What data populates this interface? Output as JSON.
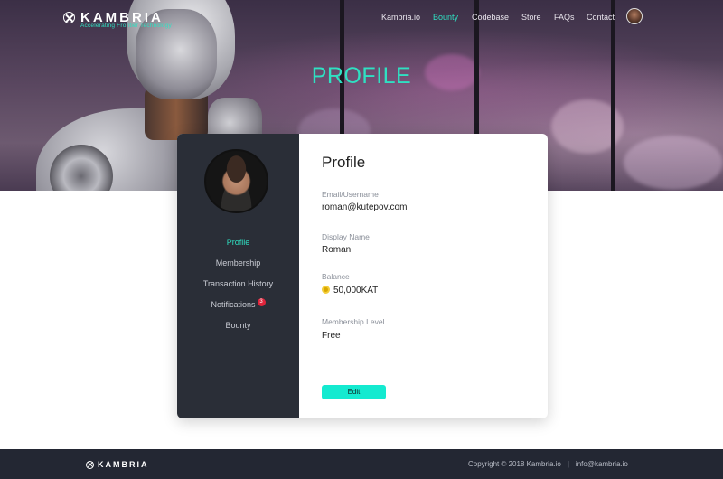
{
  "brand": {
    "name": "KAMBRIA",
    "tagline": "Accelerating Frontier Technology"
  },
  "nav": {
    "items": [
      {
        "label": "Kambria.io",
        "active": false
      },
      {
        "label": "Bounty",
        "active": true
      },
      {
        "label": "Codebase",
        "active": false
      },
      {
        "label": "Store",
        "active": false
      },
      {
        "label": "FAQs",
        "active": false
      },
      {
        "label": "Contact",
        "active": false
      }
    ]
  },
  "hero": {
    "title": "PROFILE"
  },
  "sidebar": {
    "items": [
      {
        "label": "Profile",
        "active": true
      },
      {
        "label": "Membership",
        "active": false
      },
      {
        "label": "Transaction History",
        "active": false
      },
      {
        "label": "Notifications",
        "active": false,
        "badge": "3"
      },
      {
        "label": "Bounty",
        "active": false
      }
    ]
  },
  "profile": {
    "heading": "Profile",
    "email_label": "Email/Username",
    "email_value": "roman@kutepov.com",
    "display_name_label": "Display Name",
    "display_name_value": "Roman",
    "balance_label": "Balance",
    "balance_value": "50,000KAT",
    "membership_label": "Membership Level",
    "membership_value": "Free",
    "edit_label": "Edit"
  },
  "footer": {
    "brand": "KAMBRIA",
    "copyright": "Copyright © 2018 Kambria.io",
    "separator": "|",
    "email": "info@kambria.io"
  },
  "colors": {
    "accent": "#2fe0c2",
    "sidebar_bg": "#2a2e37",
    "footer_bg": "#232733",
    "badge": "#e0243b",
    "button": "#14ead0"
  }
}
